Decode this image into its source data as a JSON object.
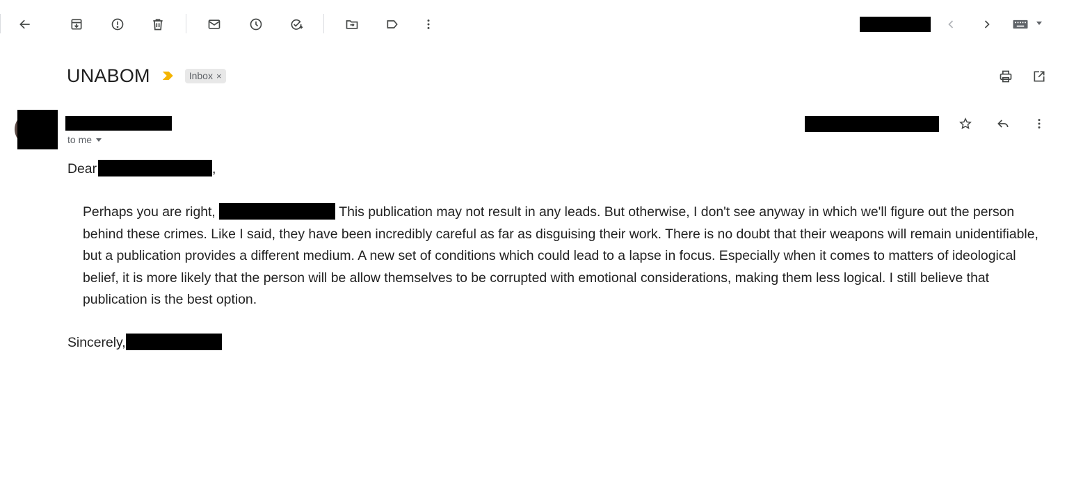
{
  "toolbar": {
    "icons": [
      "back-arrow-icon",
      "archive-icon",
      "report-spam-icon",
      "delete-icon",
      "mark-unread-icon",
      "snooze-icon",
      "add-to-tasks-icon",
      "move-to-icon",
      "labels-icon",
      "more-vertical-icon"
    ],
    "pagination": {
      "prev_icon": "chevron-left-icon",
      "next_icon": "chevron-right-icon"
    },
    "keyboard_icon": "keyboard-icon"
  },
  "email": {
    "subject": "UNABOM",
    "label": "Inbox",
    "label_remove": "×",
    "importance_color": "#f4b400",
    "to_line": "to me",
    "greeting": "Dear",
    "greeting_punct": ",",
    "body_part1": "Perhaps you are right,",
    "body_part2": " This publication may not result in any leads. But otherwise, I don't see anyway in which we'll figure out the person behind these crimes. Like I said, they have been incredibly careful as far as disguising their work. There is no doubt that their weapons will remain unidentifiable, but a publication provides a different medium. A new set of conditions which could lead to a lapse in focus. Especially when it comes to matters of ideological belief, it is more likely that the person will be allow themselves to be corrupted with emotional considerations, making them less logical. I still believe that publication is the best option.",
    "signoff": "Sincerely,"
  }
}
